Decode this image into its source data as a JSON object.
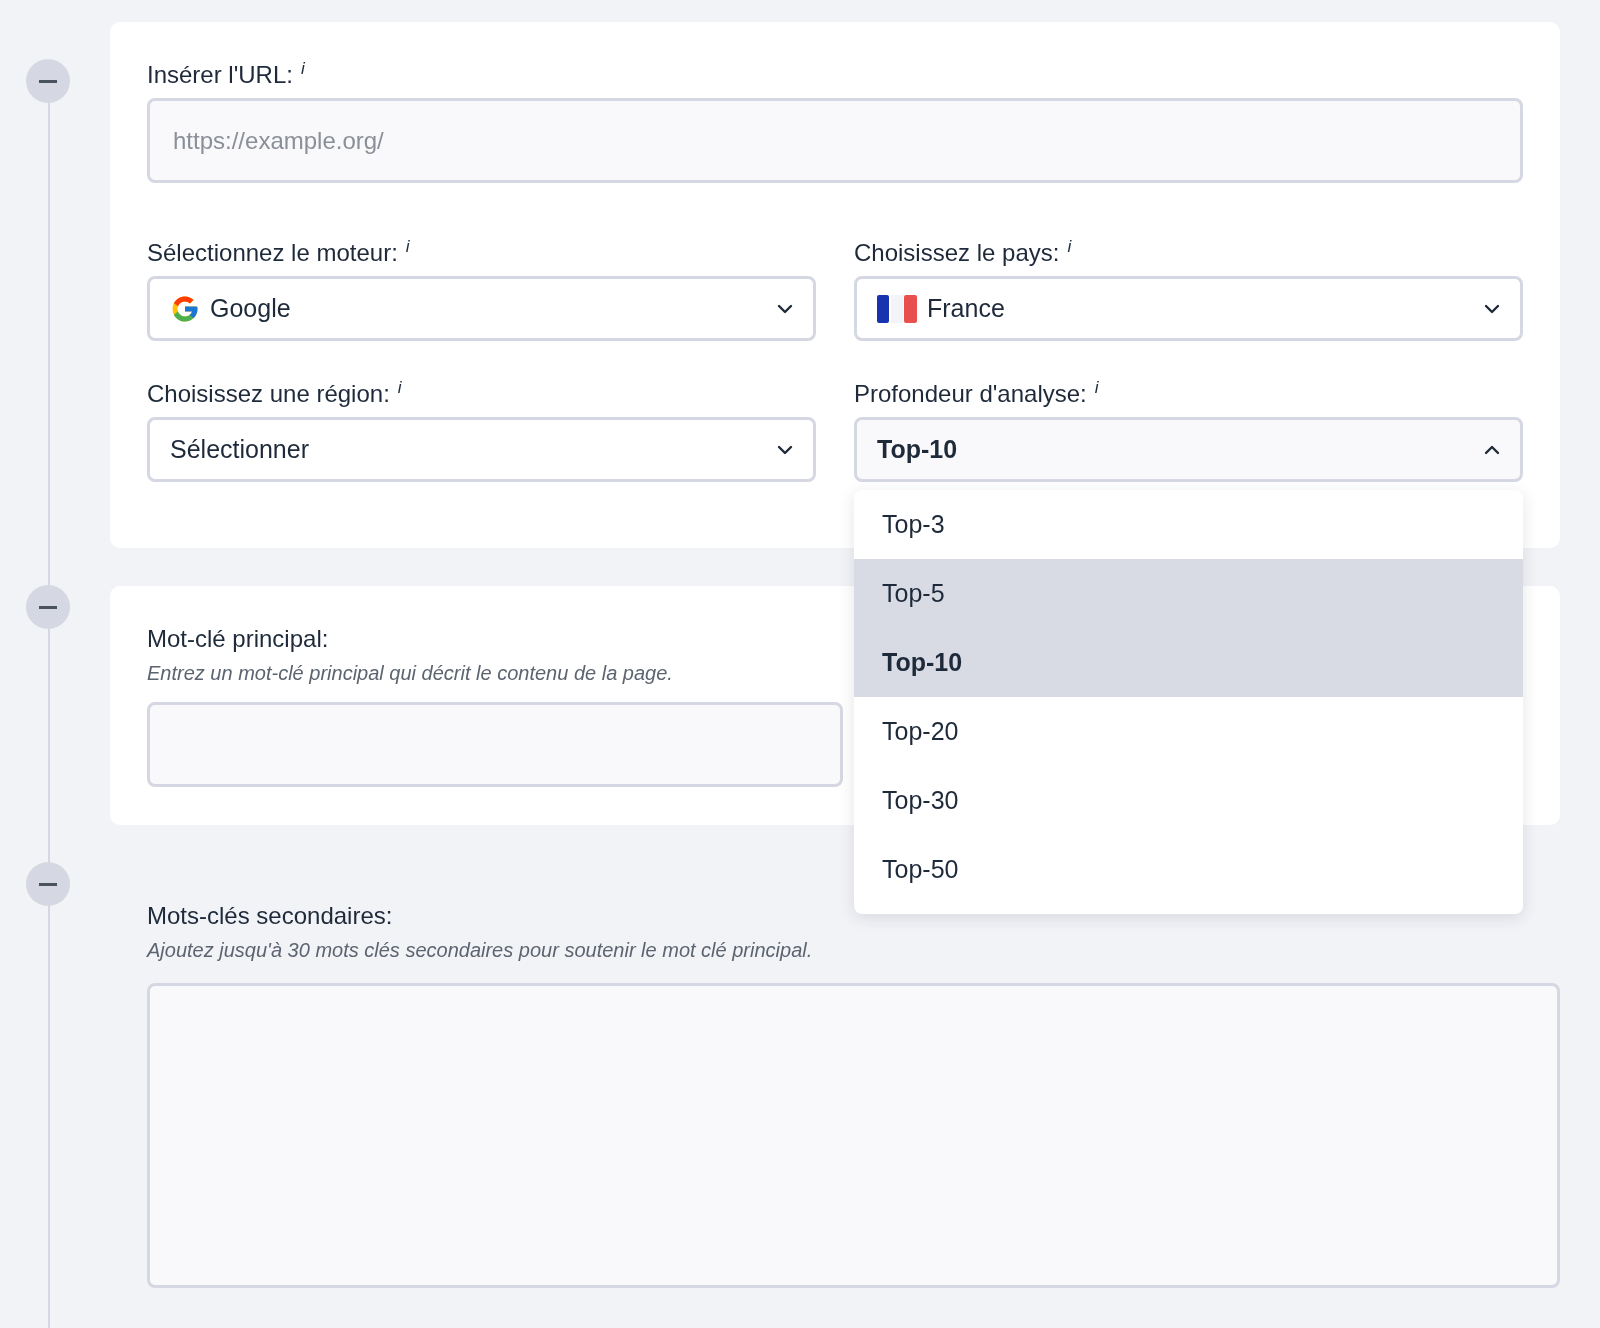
{
  "steps": [
    {
      "expanded": true
    },
    {
      "expanded": true
    },
    {
      "expanded": true
    }
  ],
  "url_field": {
    "label": "Insérer l'URL:",
    "info": "i",
    "placeholder": "https://example.org/"
  },
  "selects": [
    {
      "label": "Sélectionnez le moteur:",
      "info": "i",
      "value": "Google",
      "kind": "engine",
      "open": false
    },
    {
      "label": "Choisissez le pays:",
      "info": "i",
      "value": "France",
      "kind": "country",
      "open": false
    },
    {
      "label": "Choisissez une région:",
      "info": "i",
      "value": "Sélectionner",
      "open": false
    },
    {
      "label": "Profondeur d'analyse:",
      "info": "i",
      "value": "Top-10",
      "open": true,
      "options": [
        {
          "label": "Top-3",
          "selected": false,
          "hovered": false
        },
        {
          "label": "Top-5",
          "selected": false,
          "hovered": true
        },
        {
          "label": "Top-10",
          "selected": true,
          "hovered": false
        },
        {
          "label": "Top-20",
          "selected": false,
          "hovered": false
        },
        {
          "label": "Top-30",
          "selected": false,
          "hovered": false
        },
        {
          "label": "Top-50",
          "selected": false,
          "hovered": false
        }
      ]
    }
  ],
  "main_keyword": {
    "label": "Mot-clé principal:",
    "hint": "Entrez un mot-clé principal qui décrit le contenu de la page."
  },
  "secondary_keywords": {
    "label": "Mots-clés secondaires:",
    "hint": "Ajoutez jusqu'à 30 mots clés secondaires pour soutenir le mot clé principal."
  }
}
